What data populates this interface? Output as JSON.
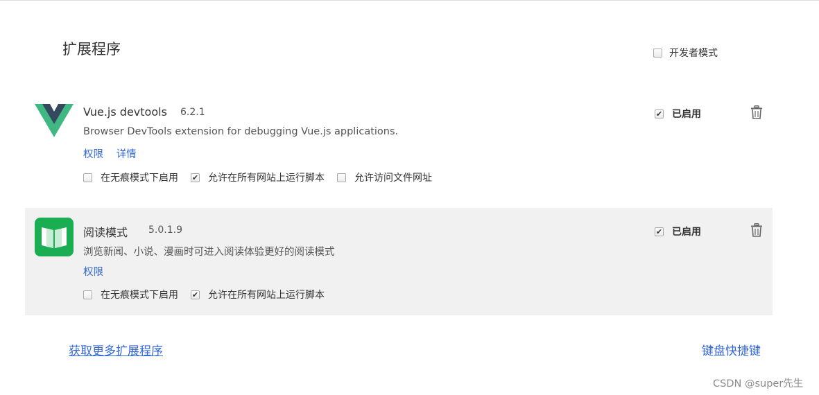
{
  "page": {
    "title": "扩展程序",
    "developer_mode": {
      "label": "开发者模式",
      "checked": false
    }
  },
  "extensions": [
    {
      "name": "Vue.js devtools",
      "version": "6.2.1",
      "description": "Browser DevTools extension for debugging Vue.js applications.",
      "links": [
        "权限",
        "详情"
      ],
      "enabled_label": "已启用",
      "enabled": true,
      "icon": "vue-logo-icon",
      "options": [
        {
          "label": "在无痕模式下启用",
          "checked": false
        },
        {
          "label": "允许在所有网站上运行脚本",
          "checked": true
        },
        {
          "label": "允许访问文件网址",
          "checked": false
        }
      ]
    },
    {
      "name": "阅读模式",
      "version": "5.0.1.9",
      "description": "浏览新闻、小说、漫画时可进入阅读体验更好的阅读模式",
      "links": [
        "权限"
      ],
      "enabled_label": "已启用",
      "enabled": true,
      "icon": "reader-book-icon",
      "options": [
        {
          "label": "在无痕模式下启用",
          "checked": false
        },
        {
          "label": "允许在所有网站上运行脚本",
          "checked": true
        }
      ]
    }
  ],
  "footer": {
    "get_more": "获取更多扩展程序",
    "shortcuts": "键盘快捷键"
  },
  "watermark": "CSDN @super先生",
  "colors": {
    "link": "#3367d6",
    "vue_green": "#41b883",
    "vue_dark": "#35495e",
    "reader_green": "#1aad52",
    "selected_row": "#f1f1f1"
  }
}
